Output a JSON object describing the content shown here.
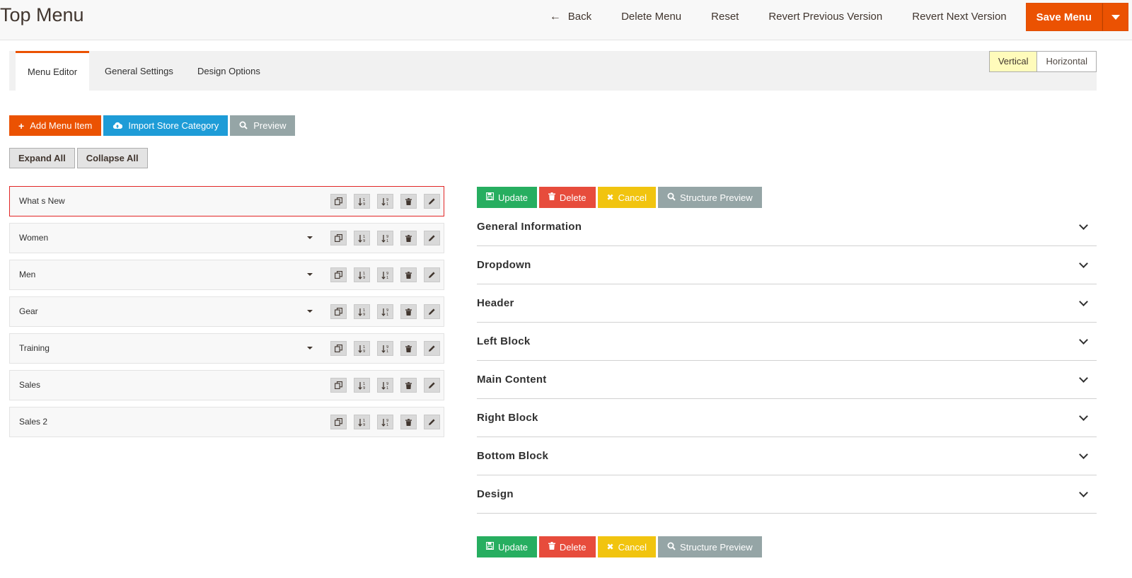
{
  "header": {
    "title": "Top Menu",
    "back_label": "Back",
    "delete_menu_label": "Delete Menu",
    "reset_label": "Reset",
    "revert_prev_label": "Revert Previous Version",
    "revert_next_label": "Revert Next Version",
    "save_label": "Save Menu"
  },
  "tabs": [
    {
      "label": "Menu Editor",
      "active": true
    },
    {
      "label": "General Settings",
      "active": false
    },
    {
      "label": "Design Options",
      "active": false
    }
  ],
  "orientation": {
    "vertical": "Vertical",
    "horizontal": "Horizontal",
    "selected": "Vertical"
  },
  "toolbar": {
    "add_item": "Add Menu Item",
    "import_category": "Import Store Category",
    "preview": "Preview",
    "expand_all": "Expand All",
    "collapse_all": "Collapse All"
  },
  "menu_items": [
    {
      "label": "What s New",
      "has_children": false,
      "selected": true
    },
    {
      "label": "Women",
      "has_children": true,
      "selected": false
    },
    {
      "label": "Men",
      "has_children": true,
      "selected": false
    },
    {
      "label": "Gear",
      "has_children": true,
      "selected": false
    },
    {
      "label": "Training",
      "has_children": true,
      "selected": false
    },
    {
      "label": "Sales",
      "has_children": false,
      "selected": false
    },
    {
      "label": "Sales 2",
      "has_children": false,
      "selected": false
    }
  ],
  "actions": {
    "update": "Update",
    "delete": "Delete",
    "cancel": "Cancel",
    "structure_preview": "Structure Preview"
  },
  "sections": [
    "General Information",
    "Dropdown",
    "Header",
    "Left Block",
    "Main Content",
    "Right Block",
    "Bottom Block",
    "Design"
  ],
  "colors": {
    "accent": "#eb5202",
    "blue": "#1e9cd7",
    "green": "#27ae60",
    "red": "#e74c3c",
    "yellow": "#f1c40f",
    "gray": "#95a5a6"
  }
}
